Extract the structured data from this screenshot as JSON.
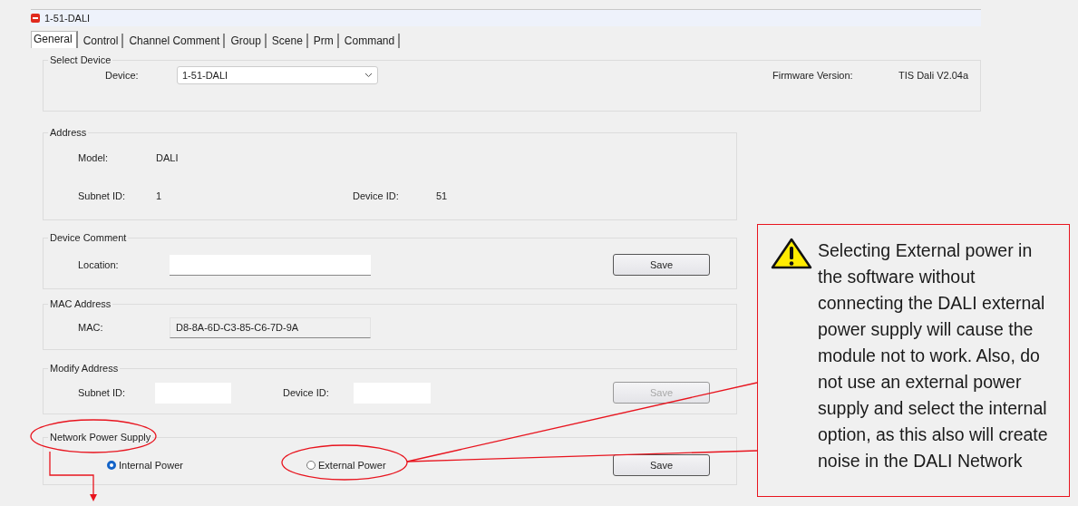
{
  "window": {
    "title": "1-51-DALI"
  },
  "tabs": [
    {
      "label": "General",
      "selected": true
    },
    {
      "label": "Control",
      "selected": false
    },
    {
      "label": "Channel Comment",
      "selected": false
    },
    {
      "label": "Group",
      "selected": false
    },
    {
      "label": "Scene",
      "selected": false
    },
    {
      "label": "Prm",
      "selected": false
    },
    {
      "label": "Command",
      "selected": false
    }
  ],
  "select_device": {
    "legend": "Select Device",
    "device_label": "Device:",
    "device_value": "1-51-DALI",
    "firmware_label": "Firmware Version:",
    "firmware_value": "TIS Dali V2.04a"
  },
  "address": {
    "legend": "Address",
    "model_label": "Model:",
    "model_value": "DALI",
    "subnet_label": "Subnet ID:",
    "subnet_value": "1",
    "device_label": "Device ID:",
    "device_value": "51"
  },
  "device_comment": {
    "legend": "Device Comment",
    "location_label": "Location:",
    "save_button": {
      "label": "Save",
      "disabled": false
    }
  },
  "mac_address": {
    "legend": "MAC Address",
    "mac_label": "MAC:",
    "mac_value": "D8-8A-6D-C3-85-C6-7D-9A"
  },
  "modify_address": {
    "legend": "Modify Address",
    "subnet_label": "Subnet ID:",
    "device_label": "Device ID:",
    "save_button": {
      "label": "Save",
      "disabled": true
    }
  },
  "network_power_supply": {
    "legend": "Network Power Supply",
    "options": [
      {
        "label": "Internal Power",
        "selected": true
      },
      {
        "label": "External Power",
        "selected": false
      }
    ],
    "save_button": {
      "label": "Save",
      "disabled": false
    }
  },
  "annotation": {
    "text": "Selecting External power in the software without connecting the DALI external power supply will cause the module not to work. Also, do not use an external power supply and select the internal option, as this also will create noise in the DALI Network"
  }
}
